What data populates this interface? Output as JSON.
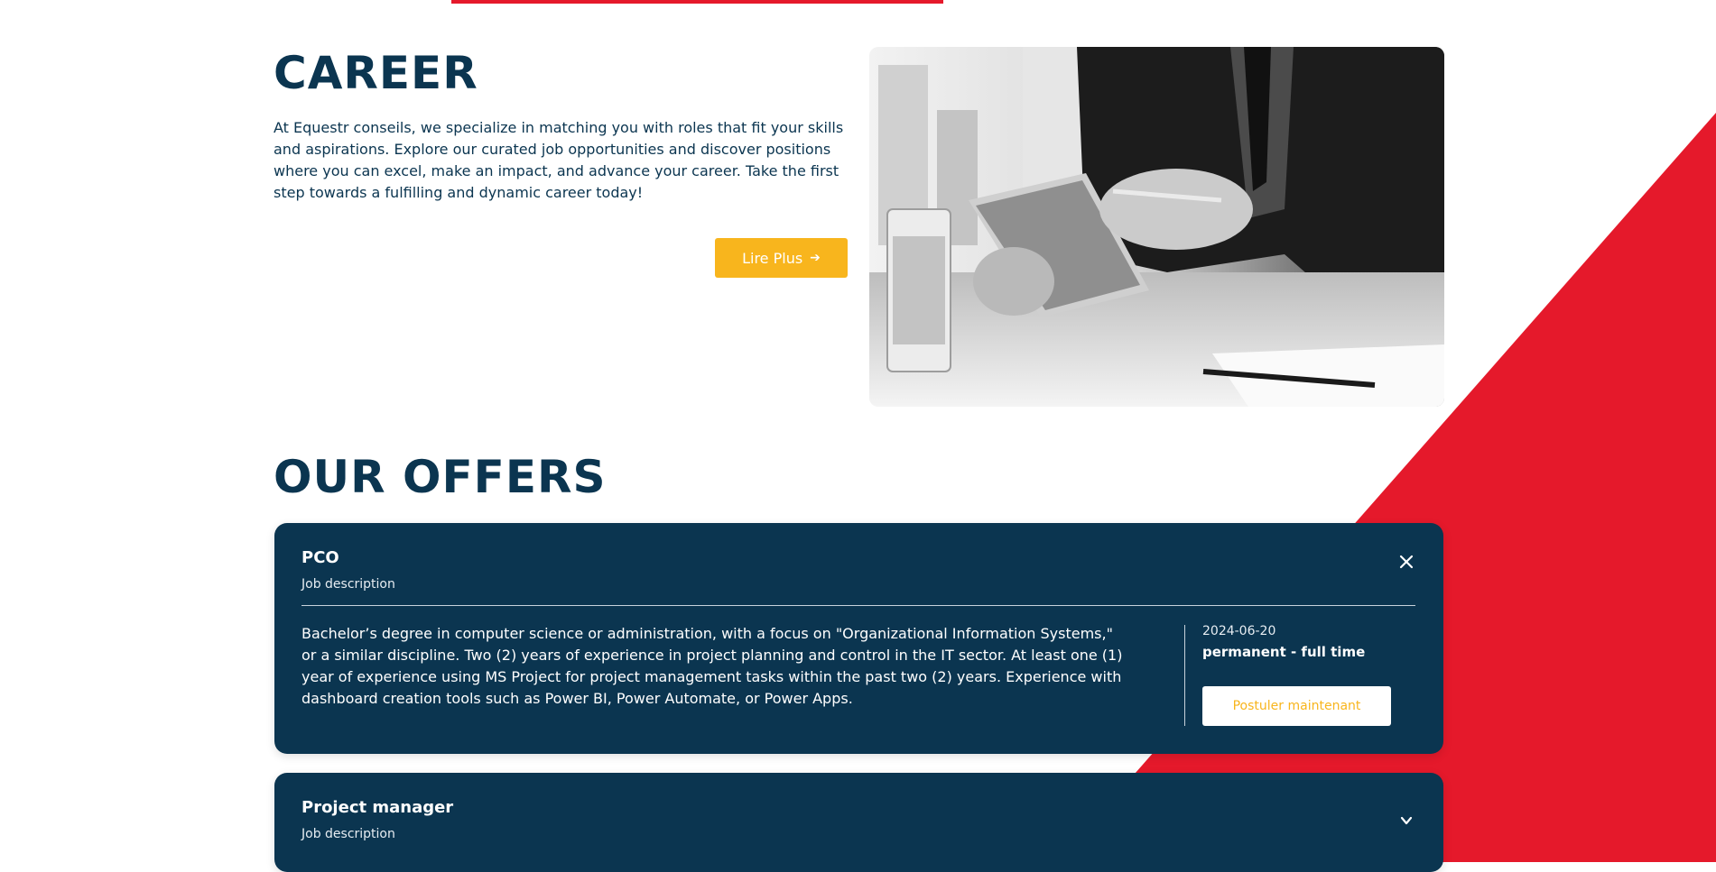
{
  "colors": {
    "navy": "#0b3550",
    "accent_red": "#e5192b",
    "accent_yellow": "#f8b51d",
    "white": "#ffffff"
  },
  "career": {
    "title": "CAREER",
    "description": "At Equestr conseils, we specialize in matching you with roles that fit your skills and aspirations. Explore our curated job opportunities and discover positions where you can excel, make an impact, and advance your career. Take the first step towards a fulfilling and dynamic career today!",
    "read_more_label": "Lire Plus",
    "read_more_icon": "arrow-right-icon",
    "image": "business-person-with-tablet-photo"
  },
  "offers": {
    "title": "OUR OFFERS",
    "items": [
      {
        "title": "PCO",
        "subtitle": "Job description",
        "expanded": true,
        "toggle_icon": "close-icon",
        "description": "Bachelor’s degree in computer science or administration, with a focus on \"Organizational Information Systems,\" or a similar discipline. Two (2) years of experience in project planning and control in the IT sector. At least one (1) year of experience using MS Project for project management tasks within the past two (2) years. Experience with dashboard creation tools such as Power BI, Power Automate, or Power Apps.",
        "date": "2024-06-20",
        "contract": "permanent - full time",
        "apply_label": "Postuler maintenant"
      },
      {
        "title": "Project manager",
        "subtitle": "Job description",
        "expanded": false,
        "toggle_icon": "chevron-down-icon"
      }
    ]
  }
}
